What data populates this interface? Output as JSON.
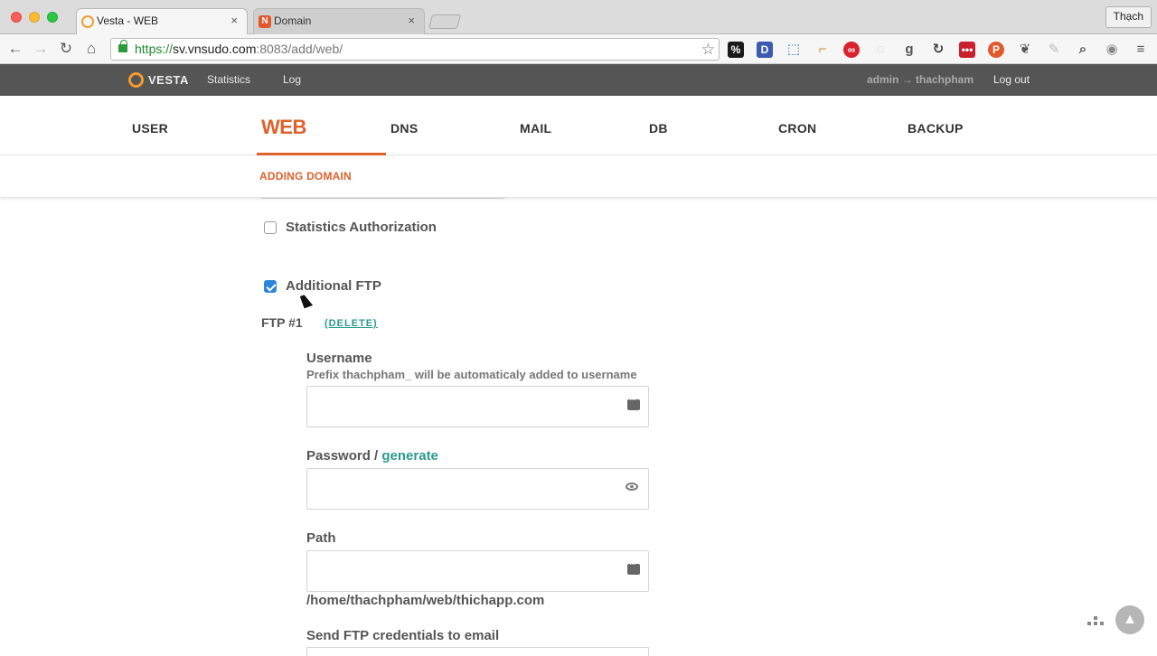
{
  "browser": {
    "tabs": [
      {
        "title": "Vesta - WEB",
        "active": true
      },
      {
        "title": "Domain",
        "active": false
      }
    ],
    "close_glyph": "×",
    "profile_name": "Thạch",
    "url": {
      "scheme": "https://",
      "host": "sv.vnsudo.com",
      "path": ":8083/add/web/"
    },
    "extensions": [
      {
        "name": "percent-icon",
        "glyph": "%",
        "color": "#1a1a1a"
      },
      {
        "name": "d-icon",
        "glyph": "D",
        "color": "#3a5bb0"
      },
      {
        "name": "screen-capture-icon",
        "glyph": "⬚",
        "color": "#2d6fb3"
      },
      {
        "name": "ruler-icon",
        "glyph": "⌐",
        "color": "#c48a2c"
      },
      {
        "name": "creative-cloud-icon",
        "glyph": "∞",
        "color": "#d9232d"
      },
      {
        "name": "circle-icon",
        "glyph": "◌",
        "color": "#bbbbbb"
      },
      {
        "name": "g-icon",
        "glyph": "g",
        "color": "#555555"
      },
      {
        "name": "sync-icon",
        "glyph": "↻",
        "color": "#444444"
      },
      {
        "name": "lastpass-icon",
        "glyph": "•••",
        "color": "#c8202d"
      },
      {
        "name": "producthunt-icon",
        "glyph": "P",
        "color": "#e05a2b"
      },
      {
        "name": "evernote-icon",
        "glyph": "❦",
        "color": "#555555"
      },
      {
        "name": "pin-icon",
        "glyph": "✎",
        "color": "#bbbbbb"
      },
      {
        "name": "search-page-icon",
        "glyph": "⌕",
        "color": "#555555"
      },
      {
        "name": "camera-icon",
        "glyph": "◉",
        "color": "#888888"
      },
      {
        "name": "menu-icon",
        "glyph": "≡",
        "color": "#555555"
      }
    ]
  },
  "topbar": {
    "logo": "VESTA",
    "nav": [
      "Statistics",
      "Log"
    ],
    "user": "admin → thachpham",
    "logout": "Log out"
  },
  "mainnav": {
    "items": [
      "USER",
      "WEB",
      "DNS",
      "MAIL",
      "DB",
      "CRON",
      "BACKUP"
    ],
    "active": "WEB"
  },
  "subbar": {
    "title": "ADDING DOMAIN"
  },
  "form": {
    "stats_auth": {
      "label": "Statistics Authorization",
      "checked": false
    },
    "additional_ftp": {
      "label": "Additional FTP",
      "checked": true
    },
    "ftp_title": "FTP #1",
    "delete_label": "(DELETE)",
    "username": {
      "label": "Username",
      "hint": "Prefix thachpham_ will be automaticaly added to username",
      "value": ""
    },
    "password": {
      "label": "Password / ",
      "generate": "generate",
      "value": ""
    },
    "path": {
      "label": "Path",
      "value": "",
      "base": "/home/thachpham/web/thichapp.com"
    },
    "send_email": {
      "label": "Send FTP credentials to email"
    }
  },
  "colors": {
    "accent": "#e0612c",
    "link": "#2b9a8e",
    "checkbox": "#2d86d9",
    "topbar": "#555555"
  }
}
